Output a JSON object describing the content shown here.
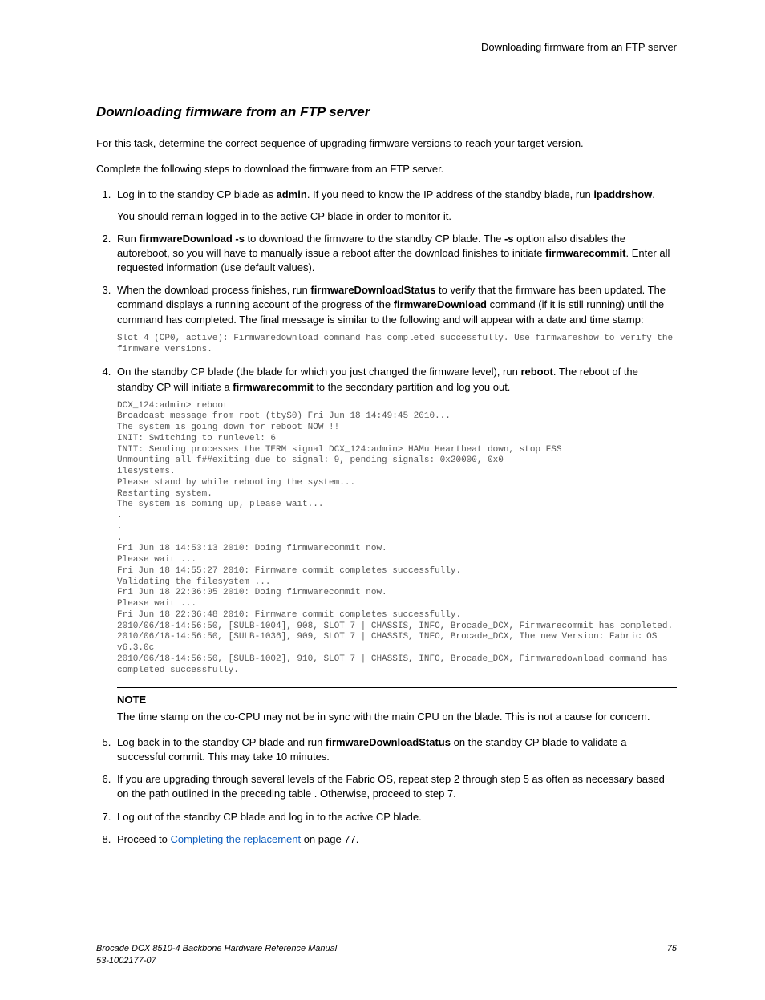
{
  "header": {
    "running_title": "Downloading firmware from an FTP server"
  },
  "section": {
    "heading": "Downloading firmware from an FTP server",
    "intro1": "For this task, determine the correct sequence of upgrading firmware versions to reach your target version.",
    "intro2": "Complete the following steps to download the firmware from an FTP server."
  },
  "steps": {
    "s1a": "Log in to the standby CP blade as ",
    "s1b": "admin",
    "s1c": ". If you need to know the IP address of the standby blade, run ",
    "s1d": "ipaddrshow",
    "s1e": ".",
    "s1f": "You should remain logged in to the active CP blade in order to monitor it.",
    "s2a": "Run ",
    "s2b": "firmwareDownload -s",
    "s2c": " to download the firmware to the standby CP blade. The ",
    "s2d": "-s",
    "s2e": " option also disables the autoreboot, so you will have to manually issue a reboot after the download finishes to initiate ",
    "s2f": "firmwarecommit",
    "s2g": ". Enter all requested information (use default values).",
    "s3a": "When the download process finishes, run ",
    "s3b": "firmwareDownloadStatus",
    "s3c": " to verify that the firmware has been updated. The command displays a running account of the progress of the ",
    "s3d": "firmwareDownload",
    "s3e": " command (if it is still running) until the command has completed. The final message is similar to the following and will appear with a date and time stamp:",
    "s3_code": "Slot 4 (CP0, active): Firmwaredownload command has completed successfully. Use firmwareshow to verify the firmware versions.",
    "s4a": "On the standby CP blade (the blade for which you just changed the firmware level), run ",
    "s4b": "reboot",
    "s4c": ". The reboot of the standby CP will initiate a ",
    "s4d": "firmwarecommit",
    "s4e": " to the secondary partition and log you out.",
    "s4_code": "DCX_124:admin> reboot\nBroadcast message from root (ttyS0) Fri Jun 18 14:49:45 2010...\nThe system is going down for reboot NOW !!\nINIT: Switching to runlevel: 6\nINIT: Sending processes the TERM signal DCX_124:admin> HAMu Heartbeat down, stop FSS\nUnmounting all f##exiting due to signal: 9, pending signals: 0x20000, 0x0\nilesystems.\nPlease stand by while rebooting the system...\nRestarting system.\nThe system is coming up, please wait...\n.\n.\n.\nFri Jun 18 14:53:13 2010: Doing firmwarecommit now.\nPlease wait ...\nFri Jun 18 14:55:27 2010: Firmware commit completes successfully.\nValidating the filesystem ...\nFri Jun 18 22:36:05 2010: Doing firmwarecommit now.\nPlease wait ...\nFri Jun 18 22:36:48 2010: Firmware commit completes successfully.\n2010/06/18-14:56:50, [SULB-1004], 908, SLOT 7 | CHASSIS, INFO, Brocade_DCX, Firmwarecommit has completed.\n2010/06/18-14:56:50, [SULB-1036], 909, SLOT 7 | CHASSIS, INFO, Brocade_DCX, The new Version: Fabric OS v6.3.0c\n2010/06/18-14:56:50, [SULB-1002], 910, SLOT 7 | CHASSIS, INFO, Brocade_DCX, Firmwaredownload command has completed successfully.",
    "note_title": "NOTE",
    "note_text": "The time stamp on the co-CPU may not be in sync with the main CPU on the blade. This is not a cause for concern.",
    "s5a": "Log back in to the standby CP blade and run ",
    "s5b": "firmwareDownloadStatus",
    "s5c": " on the standby CP blade to validate a successful commit. This may take 10 minutes.",
    "s6": "If you are upgrading through several levels of the Fabric OS, repeat step 2 through step 5 as often as necessary based on the path outlined in the preceding table . Otherwise, proceed to step 7.",
    "s7": "Log out of the standby CP blade and log in to the active CP blade.",
    "s8a": "Proceed to ",
    "s8b": "Completing the replacement",
    "s8c": " on page 77."
  },
  "footer": {
    "title": "Brocade DCX 8510-4 Backbone Hardware Reference Manual",
    "docnum": "53-1002177-07",
    "page": "75"
  }
}
